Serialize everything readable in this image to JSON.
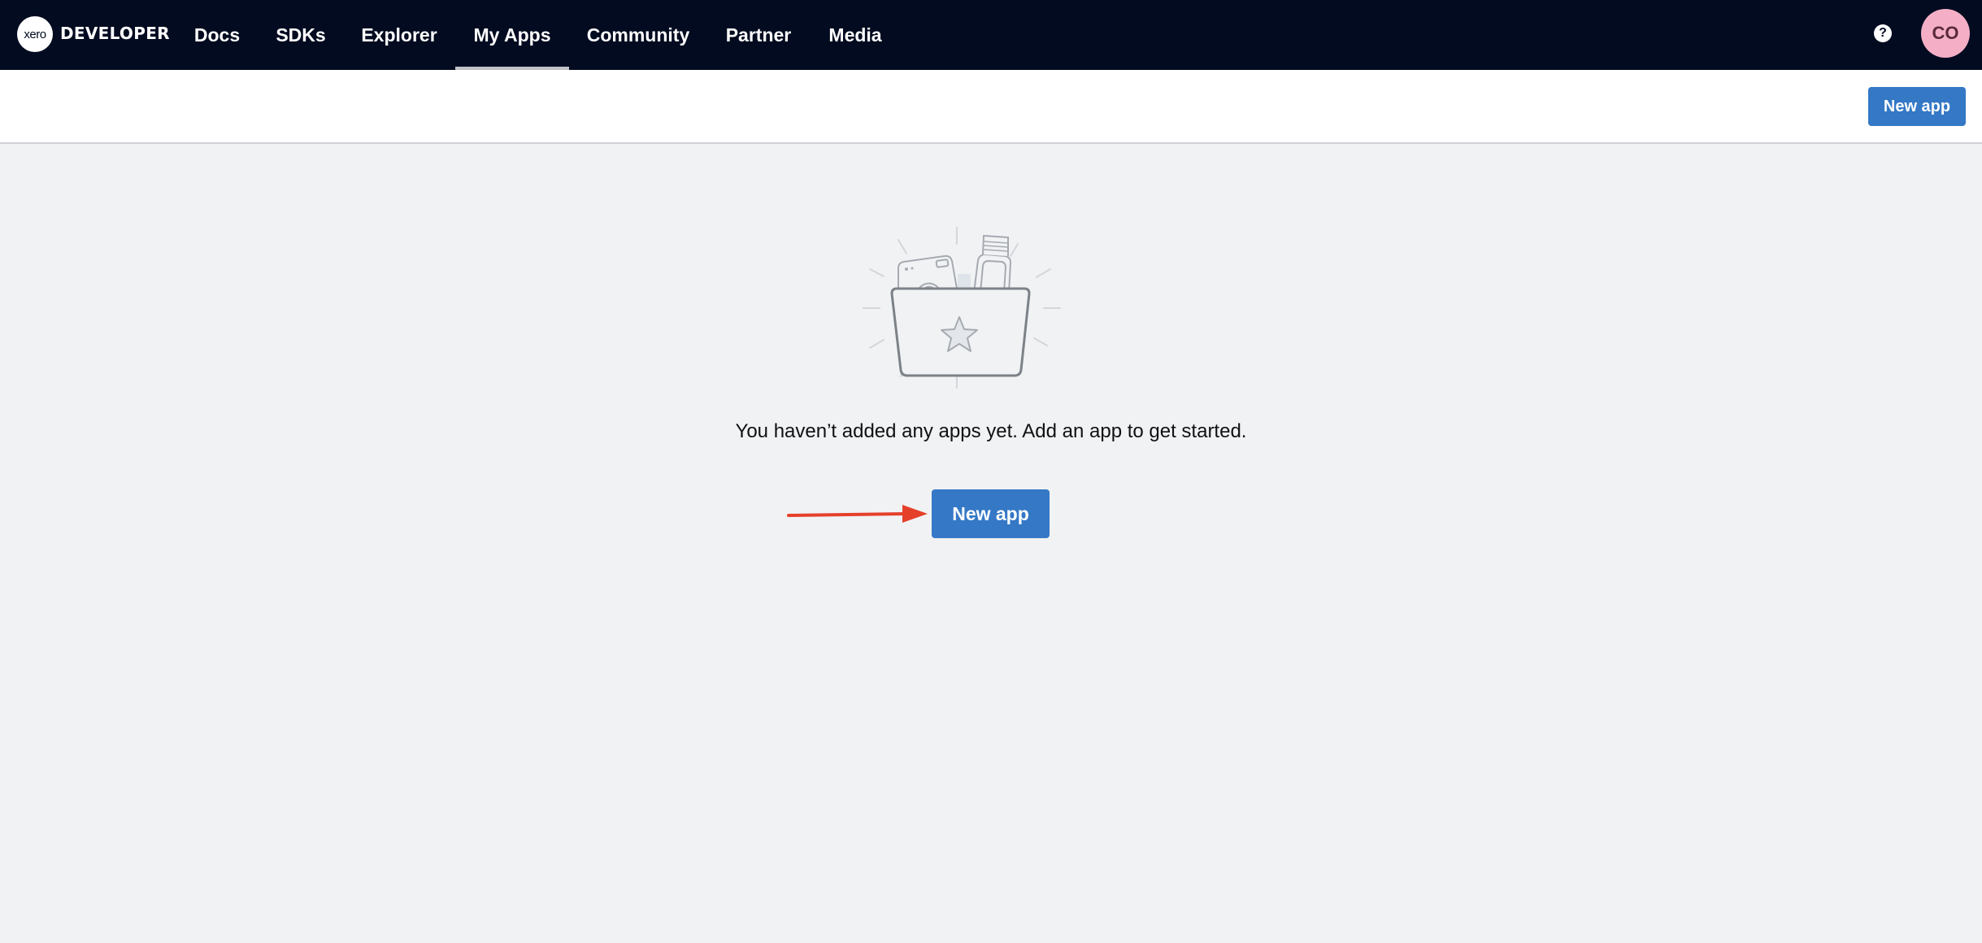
{
  "topnav": {
    "logo_text": "xero",
    "brand": "DEVELOPER",
    "items": [
      {
        "label": "Docs",
        "active": false
      },
      {
        "label": "SDKs",
        "active": false
      },
      {
        "label": "Explorer",
        "active": false
      },
      {
        "label": "My Apps",
        "active": true
      },
      {
        "label": "Community",
        "active": false
      },
      {
        "label": "Partner",
        "active": false
      },
      {
        "label": "Media",
        "active": false
      }
    ],
    "help_icon": "question-circle-icon",
    "help_glyph": "?",
    "avatar_initials": "CO"
  },
  "subheader": {
    "new_app_label": "New app"
  },
  "empty_state": {
    "illustration": "folder-with-apps-illustration",
    "message": "You haven’t added any apps yet. Add an app to get started.",
    "new_app_label": "New app"
  },
  "colors": {
    "nav_bg": "#020b20",
    "primary_button": "#3478c6",
    "avatar_bg": "#f4afc6",
    "page_bg": "#f1f2f4",
    "annotation_arrow": "#e5402a"
  }
}
